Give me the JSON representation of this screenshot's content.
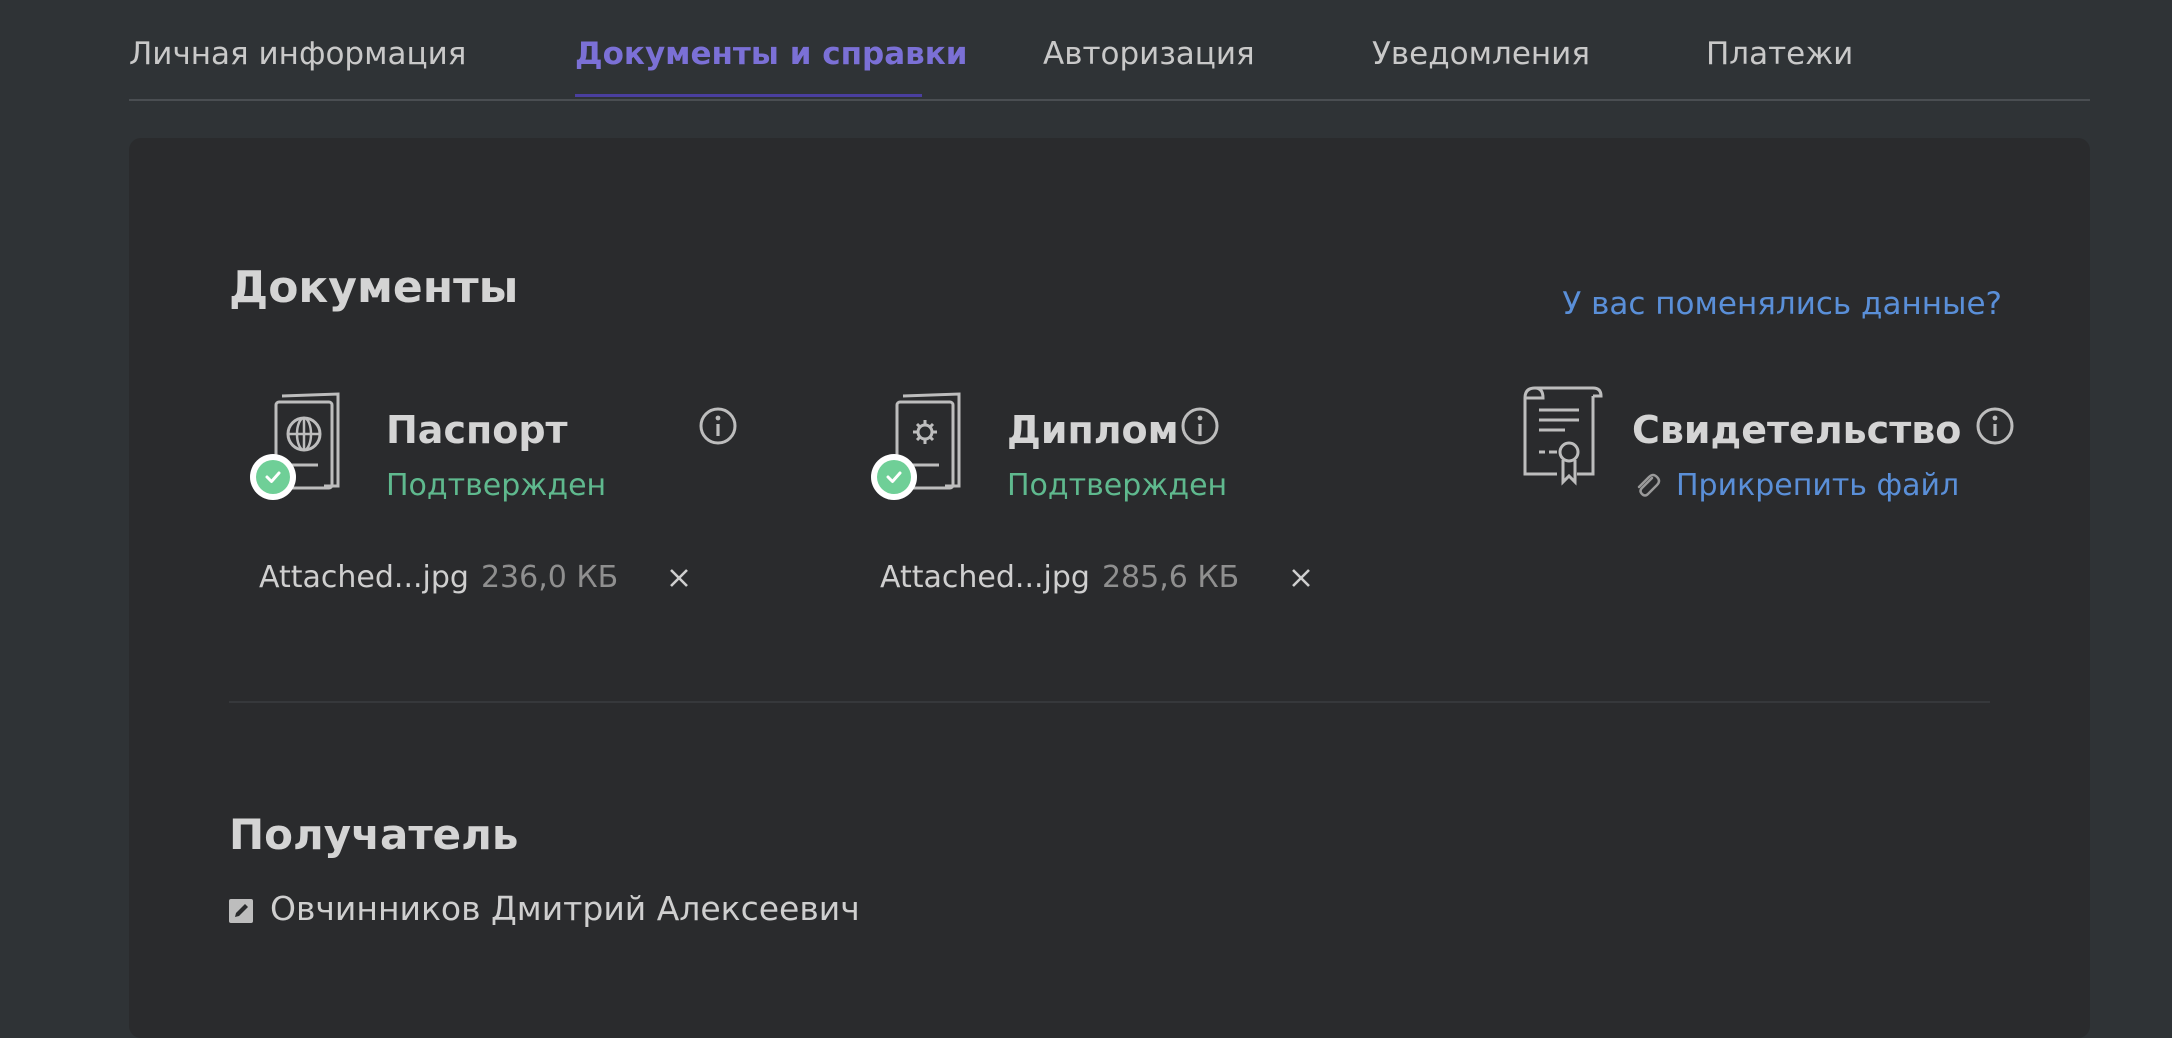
{
  "tabs": [
    {
      "label": "Личная информация",
      "active": false
    },
    {
      "label": "Документы и справки",
      "active": true
    },
    {
      "label": "Авторизация",
      "active": false
    },
    {
      "label": "Уведомления",
      "active": false
    },
    {
      "label": "Платежи",
      "active": false
    }
  ],
  "documents": {
    "title": "Документы",
    "changed_link": "У вас поменялись данные?",
    "items": [
      {
        "name": "Паспорт",
        "icon": "passport-icon",
        "status": "Подтвержден",
        "file": {
          "name": "Attached...jpg",
          "size": "236,0 КБ"
        }
      },
      {
        "name": "Диплом",
        "icon": "diploma-icon",
        "status": "Подтвержден",
        "file": {
          "name": "Attached...jpg",
          "size": "285,6 КБ"
        }
      },
      {
        "name": "Свидетельство",
        "icon": "certificate-icon",
        "action": "Прикрепить файл"
      }
    ]
  },
  "recipient": {
    "title": "Получатель",
    "name": "Овчинников Дмитрий Алексеевич"
  },
  "colors": {
    "background": "#2f3336",
    "card": "#2a2b2d",
    "accent": "#7b70d6",
    "link": "#5a8fd8",
    "success": "#5fb98e"
  }
}
